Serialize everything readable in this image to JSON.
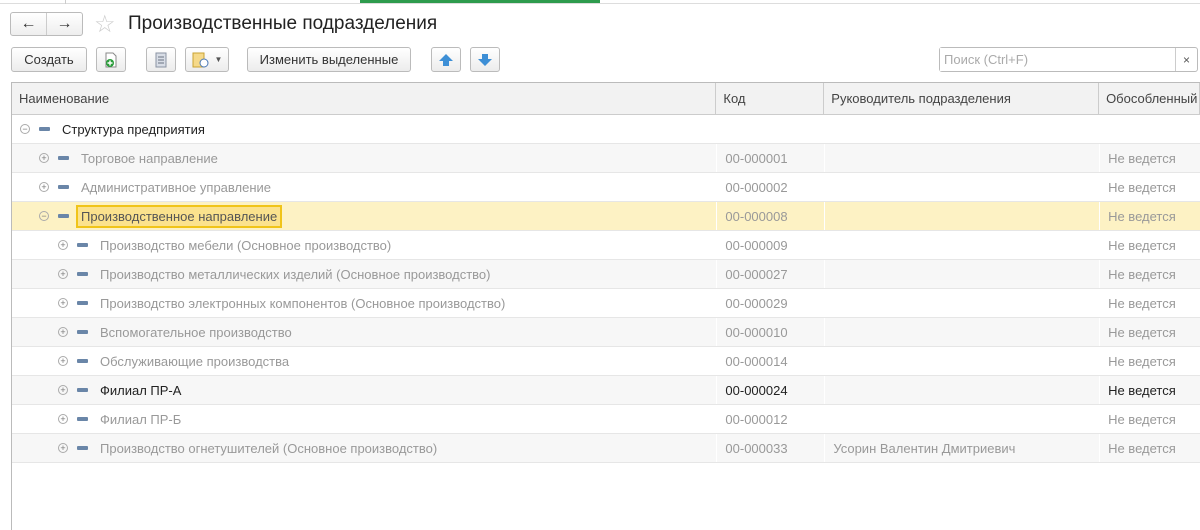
{
  "window": {
    "title": "Производственные подразделения"
  },
  "nav": {
    "back_icon": "←",
    "forward_icon": "→",
    "favorite_icon": "☆"
  },
  "toolbar": {
    "create_label": "Создать",
    "change_selected_label": "Изменить выделенные",
    "search_placeholder": "Поиск (Ctrl+F)",
    "search_clear": "×"
  },
  "table": {
    "columns": [
      "Наименование",
      "Код",
      "Руководитель подразделения",
      "Обособленный учет"
    ],
    "rows": [
      {
        "level": 0,
        "expanded": true,
        "name": "Структура предприятия",
        "code": "",
        "head": "",
        "separate": "",
        "style": "dark"
      },
      {
        "level": 1,
        "expanded": false,
        "name": "Торговое направление",
        "code": "00-000001",
        "head": "",
        "separate": "Не ведется",
        "style": "muted"
      },
      {
        "level": 1,
        "expanded": false,
        "name": "Административное управление",
        "code": "00-000002",
        "head": "",
        "separate": "Не ведется",
        "style": "muted"
      },
      {
        "level": 1,
        "expanded": true,
        "name": "Производственное направление",
        "code": "00-000008",
        "head": "",
        "separate": "Не ведется",
        "style": "selected"
      },
      {
        "level": 2,
        "expanded": false,
        "name": "Производство мебели (Основное производство)",
        "code": "00-000009",
        "head": "",
        "separate": "Не ведется",
        "style": "muted"
      },
      {
        "level": 2,
        "expanded": false,
        "name": "Производство металлических изделий (Основное производство)",
        "code": "00-000027",
        "head": "",
        "separate": "Не ведется",
        "style": "muted"
      },
      {
        "level": 2,
        "expanded": false,
        "name": "Производство электронных компонентов (Основное производство)",
        "code": "00-000029",
        "head": "",
        "separate": "Не ведется",
        "style": "muted"
      },
      {
        "level": 2,
        "expanded": false,
        "name": "Вспомогательное производство",
        "code": "00-000010",
        "head": "",
        "separate": "Не ведется",
        "style": "muted"
      },
      {
        "level": 2,
        "expanded": false,
        "name": "Обслуживающие производства",
        "code": "00-000014",
        "head": "",
        "separate": "Не ведется",
        "style": "muted"
      },
      {
        "level": 2,
        "expanded": false,
        "name": "Филиал ПР-А",
        "code": "00-000024",
        "head": "",
        "separate": "Не ведется",
        "style": "dark"
      },
      {
        "level": 2,
        "expanded": false,
        "name": "Филиал ПР-Б",
        "code": "00-000012",
        "head": "",
        "separate": "Не ведется",
        "style": "muted"
      },
      {
        "level": 2,
        "expanded": false,
        "name": "Производство огнетушителей (Основное производство)",
        "code": "00-000033",
        "head": "Усорин Валентин Дмитриевич",
        "separate": "Не ведется",
        "style": "muted"
      }
    ]
  }
}
